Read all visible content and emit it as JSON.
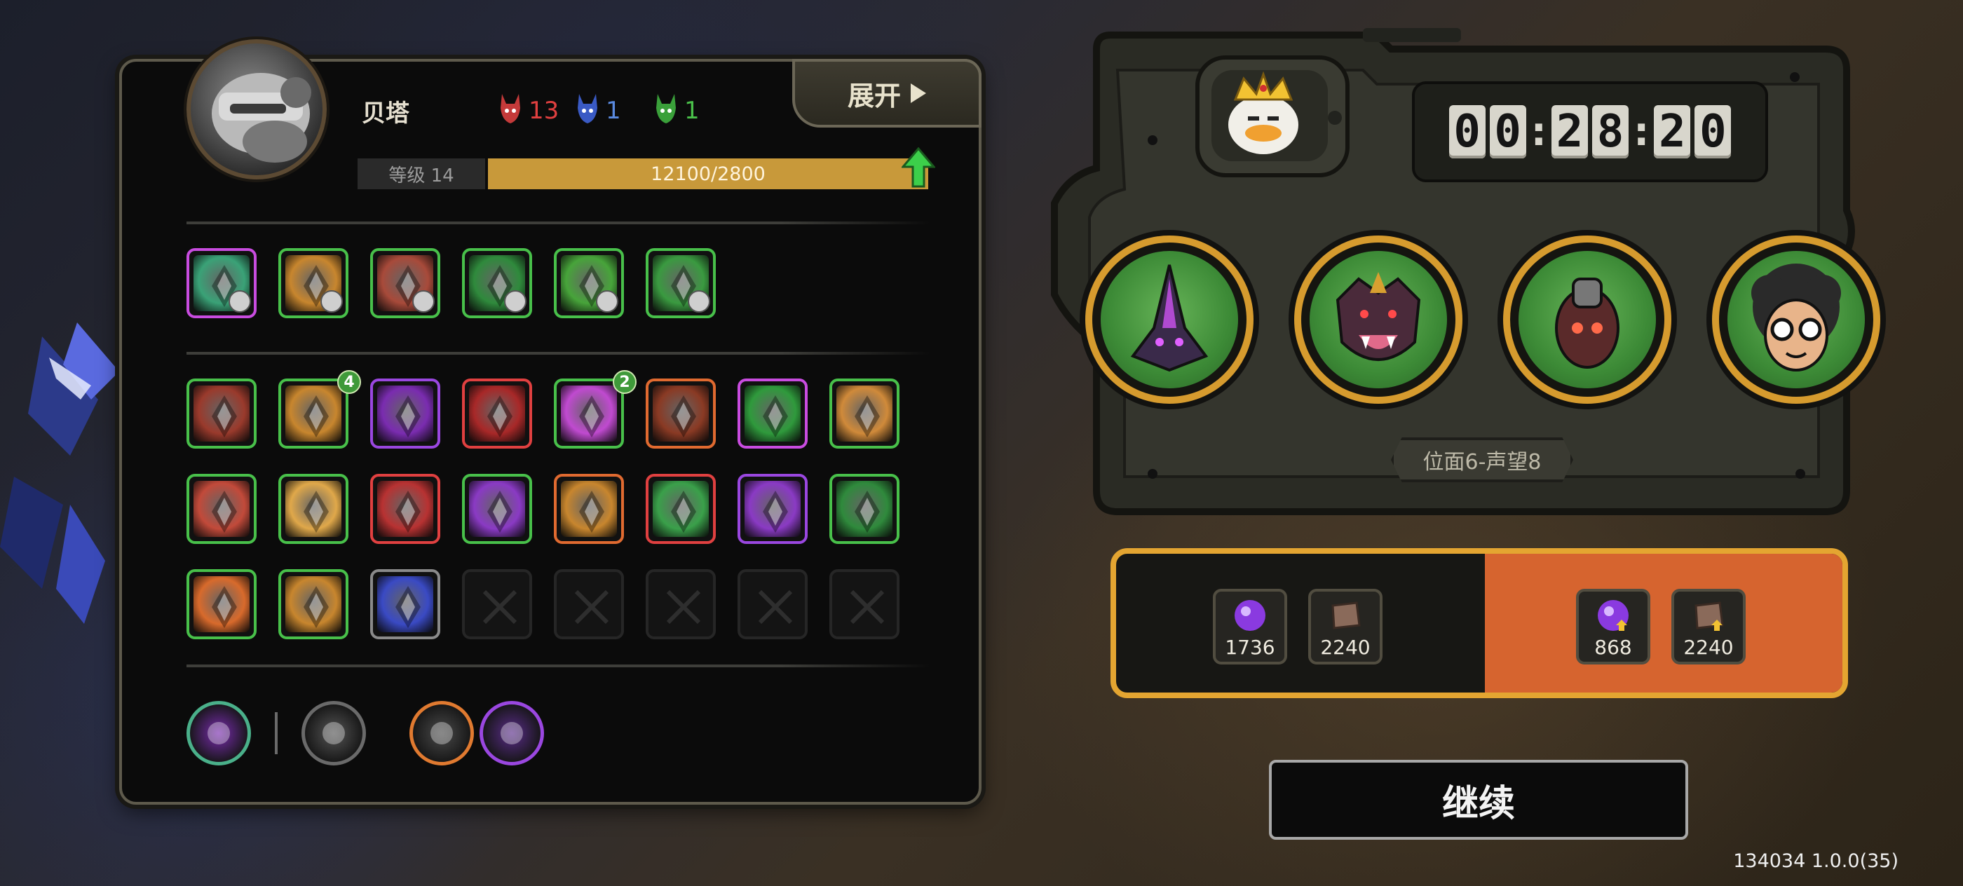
{
  "panel": {
    "expand_label": "展开",
    "player_name": "贝塔",
    "stats": {
      "red": "13",
      "blue": "1",
      "green": "1"
    },
    "level_label": "等级 14",
    "exp_text": "12100/2800",
    "exp_fill_fraction": 1.0
  },
  "top_skills": [
    {
      "name": "crosshair-skill-icon",
      "frame": "#c94ce0",
      "bg": "#3aa277"
    },
    {
      "name": "turtle-skill-icon",
      "frame": "#48c04a",
      "bg": "#c8862e"
    },
    {
      "name": "claw-skill-icon",
      "frame": "#48c04a",
      "bg": "#a84a3a"
    },
    {
      "name": "spike-skill-icon",
      "frame": "#48c04a",
      "bg": "#2f8a3c"
    },
    {
      "name": "vine-skill-icon",
      "frame": "#48c04a",
      "bg": "#47a43a"
    },
    {
      "name": "shell-skill-icon",
      "frame": "#48c04a",
      "bg": "#3a9a40"
    }
  ],
  "grid_rows": [
    [
      {
        "name": "hand-skill-icon",
        "frame": "#48c04a",
        "bg": "#9a3a2c"
      },
      {
        "name": "burst-skill-icon",
        "frame": "#48c04a",
        "bg": "#c8862e",
        "badge": "4"
      },
      {
        "name": "crown-spike-skill-icon",
        "frame": "#9a47e0",
        "bg": "#7a2cb0"
      },
      {
        "name": "slash-skill-icon",
        "frame": "#e04040",
        "bg": "#a82828"
      },
      {
        "name": "orb-skill-icon",
        "frame": "#48c04a",
        "bg": "#c04ad0",
        "badge": "2"
      },
      {
        "name": "wheel-skill-icon",
        "frame": "#e06a30",
        "bg": "#8a3a24"
      },
      {
        "name": "bolt-skill-icon",
        "frame": "#c94ce0",
        "bg": "#2f9a3c"
      },
      {
        "name": "chain-skill-icon",
        "frame": "#48c04a",
        "bg": "#d08a3a"
      }
    ],
    [
      {
        "name": "arrow-skill-icon",
        "frame": "#48c04a",
        "bg": "#c24a3a"
      },
      {
        "name": "sunrise-skill-icon",
        "frame": "#48c04a",
        "bg": "#e0a84a"
      },
      {
        "name": "blade-skill-icon",
        "frame": "#e04040",
        "bg": "#b83232"
      },
      {
        "name": "beast-skill-icon",
        "frame": "#48c04a",
        "bg": "#8a3ac4"
      },
      {
        "name": "flame-skill-icon",
        "frame": "#e06a30",
        "bg": "#c8862e"
      },
      {
        "name": "shield-skill-icon",
        "frame": "#e04040",
        "bg": "#3aa04a"
      },
      {
        "name": "scythe-skill-icon",
        "frame": "#9a47e0",
        "bg": "#8a3ac4"
      },
      {
        "name": "spikes-skill-icon",
        "frame": "#48c04a",
        "bg": "#2f8a3c"
      }
    ],
    [
      {
        "name": "phoenix-skill-icon",
        "frame": "#48c04a",
        "bg": "#d86a2c"
      },
      {
        "name": "rockfall-skill-icon",
        "frame": "#48c04a",
        "bg": "#c8862e"
      },
      {
        "name": "storm-skill-icon",
        "frame": "#8a8a8a",
        "bg": "#3a4ac4"
      }
    ]
  ],
  "empty_slots": 5,
  "bottom_icons": [
    {
      "name": "vortex-icon",
      "ring": "#4ab08a",
      "bg": "#7a2cb0"
    },
    {
      "name": "sword-icon",
      "ring": "#6a6a6a",
      "bg": "#555555"
    },
    {
      "name": "gate-icon",
      "ring": "#e07a30",
      "bg": "#4a4a4a"
    },
    {
      "name": "wing-icon",
      "ring": "#9a47e0",
      "bg": "#5a2c8a"
    }
  ],
  "timer": {
    "h1": "0",
    "h2": "0",
    "m1": "2",
    "m2": "8",
    "s1": "2",
    "s2": "0"
  },
  "heroes": [
    "insect-hero-icon",
    "fanged-hero-icon",
    "beetle-hero-icon",
    "glasses-hero-icon"
  ],
  "position_label": "位面6-声望8",
  "rewards_left": [
    {
      "name": "orb-reward-icon",
      "value": "1736"
    },
    {
      "name": "book-reward-icon",
      "value": "2240"
    }
  ],
  "rewards_right": [
    {
      "name": "orb-upgrade-reward-icon",
      "value": "868"
    },
    {
      "name": "book-upgrade-reward-icon",
      "value": "2240"
    }
  ],
  "continue_label": "继续",
  "version": "134034 1.0.0(35)",
  "colors": {
    "accent": "#e4a531",
    "reward_highlight": "#d6642f",
    "exp": "#c8993a"
  }
}
